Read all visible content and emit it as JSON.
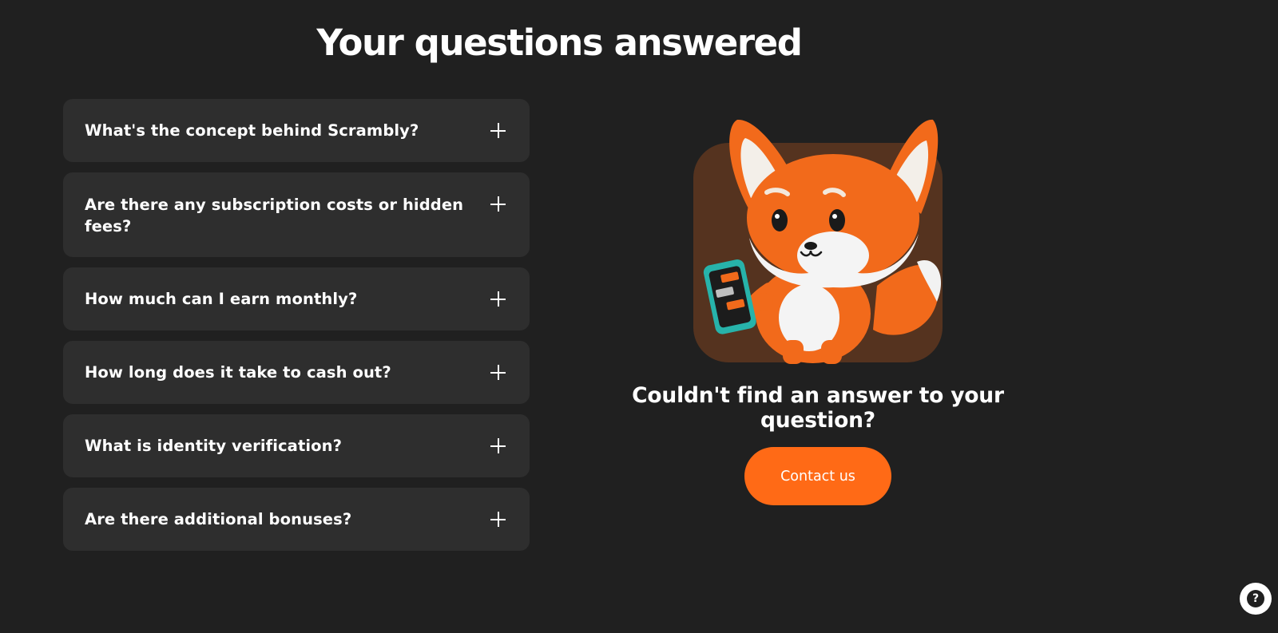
{
  "page": {
    "title": "Your questions answered"
  },
  "faq": {
    "items": [
      {
        "question": "What's the concept behind Scrambly?"
      },
      {
        "question": "Are there any subscription costs or hidden fees?"
      },
      {
        "question": "How much can I earn monthly?"
      },
      {
        "question": "How long does it take to cash out?"
      },
      {
        "question": "What is identity verification?"
      },
      {
        "question": "Are there additional bonuses?"
      }
    ]
  },
  "help_panel": {
    "heading": "Couldn't find an answer to your question?",
    "contact_label": "Contact us",
    "mascot_icon": "fox-mascot-icon"
  },
  "help_widget": {
    "icon": "question-mark-icon",
    "glyph": "?"
  },
  "colors": {
    "background": "#202020",
    "card": "#2e2e2e",
    "accent": "#ff6a16",
    "mascot_bg": "#55331f"
  }
}
